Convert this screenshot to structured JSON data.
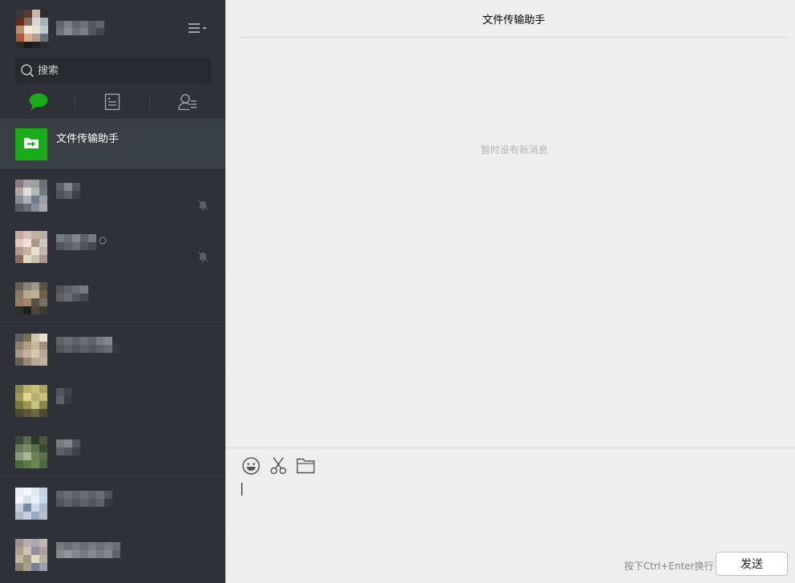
{
  "app": {
    "accent": "#1aad19",
    "sidebar_bg": "#2e3238"
  },
  "profile": {
    "avatar": "pixelated-avatar",
    "name": ""
  },
  "search": {
    "placeholder": "搜索",
    "value": ""
  },
  "nav": {
    "tabs": [
      {
        "name": "chat",
        "icon": "chat-bubble-icon",
        "active": true
      },
      {
        "name": "public-accounts",
        "icon": "article-icon",
        "active": false
      },
      {
        "name": "contacts",
        "icon": "contacts-icon",
        "active": false
      }
    ]
  },
  "contacts": [
    {
      "name": "文件传输助手",
      "active": true,
      "avatar": "file-transfer-icon",
      "muted": false
    },
    {
      "name": "",
      "active": false,
      "avatar": "pixelated-avatar",
      "muted": true
    },
    {
      "name": "",
      "active": false,
      "avatar": "pixelated-avatar",
      "muted": true
    },
    {
      "name": "",
      "active": false,
      "avatar": "pixelated-avatar",
      "muted": false
    },
    {
      "name": "",
      "active": false,
      "avatar": "pixelated-avatar",
      "muted": false
    },
    {
      "name": "",
      "active": false,
      "avatar": "pixelated-avatar",
      "muted": false
    },
    {
      "name": "",
      "active": false,
      "avatar": "pixelated-avatar",
      "muted": false
    },
    {
      "name": "",
      "active": false,
      "avatar": "pixelated-avatar",
      "muted": false
    },
    {
      "name": "",
      "active": false,
      "avatar": "pixelated-avatar",
      "muted": false
    }
  ],
  "chat": {
    "title": "文件传输助手",
    "empty_message": "暂时没有新消息"
  },
  "composer": {
    "tools": [
      "emoji-icon",
      "scissors-icon",
      "folder-icon"
    ],
    "input_value": "",
    "hint": "按下Ctrl+Enter换行",
    "send_label": "发送"
  }
}
